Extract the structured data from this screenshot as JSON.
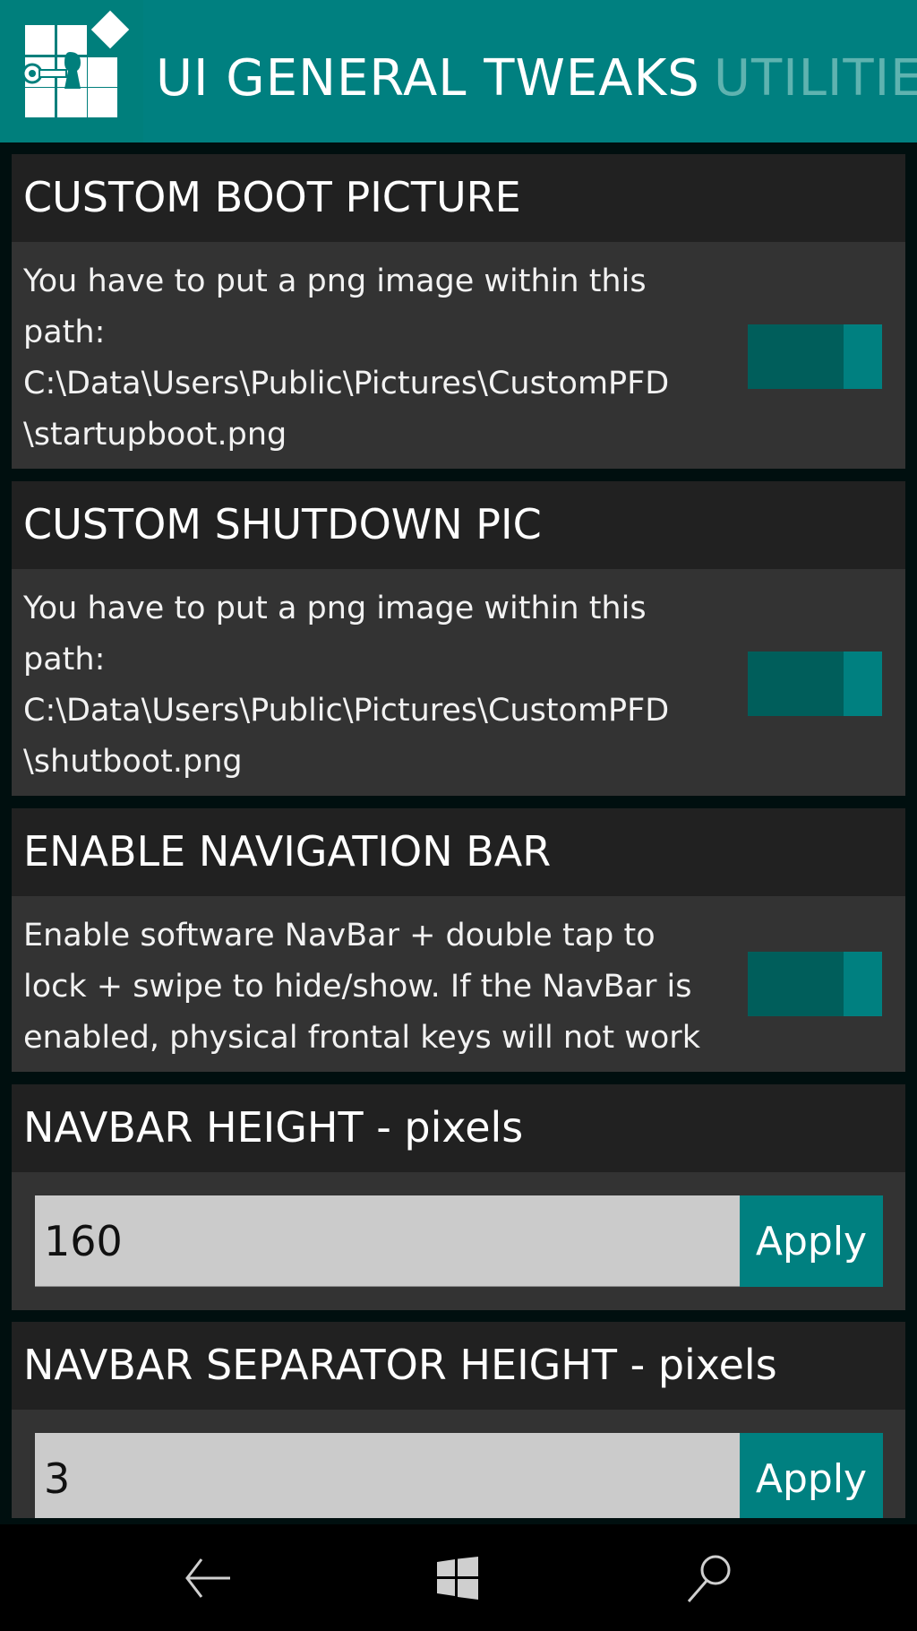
{
  "header": {
    "tabs": [
      {
        "label": "UI GENERAL TWEAKS",
        "active": true
      },
      {
        "label": "UTILITIES",
        "active": false
      }
    ],
    "logo_icon": "key-lock-tiles-icon"
  },
  "settings": [
    {
      "title": "CUSTOM BOOT PICTURE",
      "description": "You have to put a png image within this path: C:\\Data\\Users\\Public\\Pictures\\CustomPFD \\startupboot.png",
      "control": "toggle",
      "enabled": true
    },
    {
      "title": "CUSTOM SHUTDOWN PIC",
      "description": "You have to put a png image within this path: C:\\Data\\Users\\Public\\Pictures\\CustomPFD \\shutboot.png",
      "control": "toggle",
      "enabled": true
    },
    {
      "title": "ENABLE NAVIGATION BAR",
      "description": "Enable software NavBar + double tap to lock + swipe to hide/show. If the NavBar is enabled, physical frontal keys will not work",
      "control": "toggle",
      "enabled": true
    },
    {
      "title": "NAVBAR HEIGHT - pixels",
      "control": "input",
      "value": "160",
      "button_label": "Apply"
    },
    {
      "title": "NAVBAR SEPARATOR HEIGHT - pixels",
      "control": "input",
      "value": "3",
      "button_label": "Apply"
    }
  ],
  "system_nav": {
    "back": "back-arrow-icon",
    "home": "windows-logo-icon",
    "search": "search-icon"
  },
  "colors": {
    "accent": "#008080",
    "toggle_track": "#005e5b",
    "card_header": "#212121",
    "card_body": "#333333",
    "input_bg": "#cbcbcb"
  }
}
